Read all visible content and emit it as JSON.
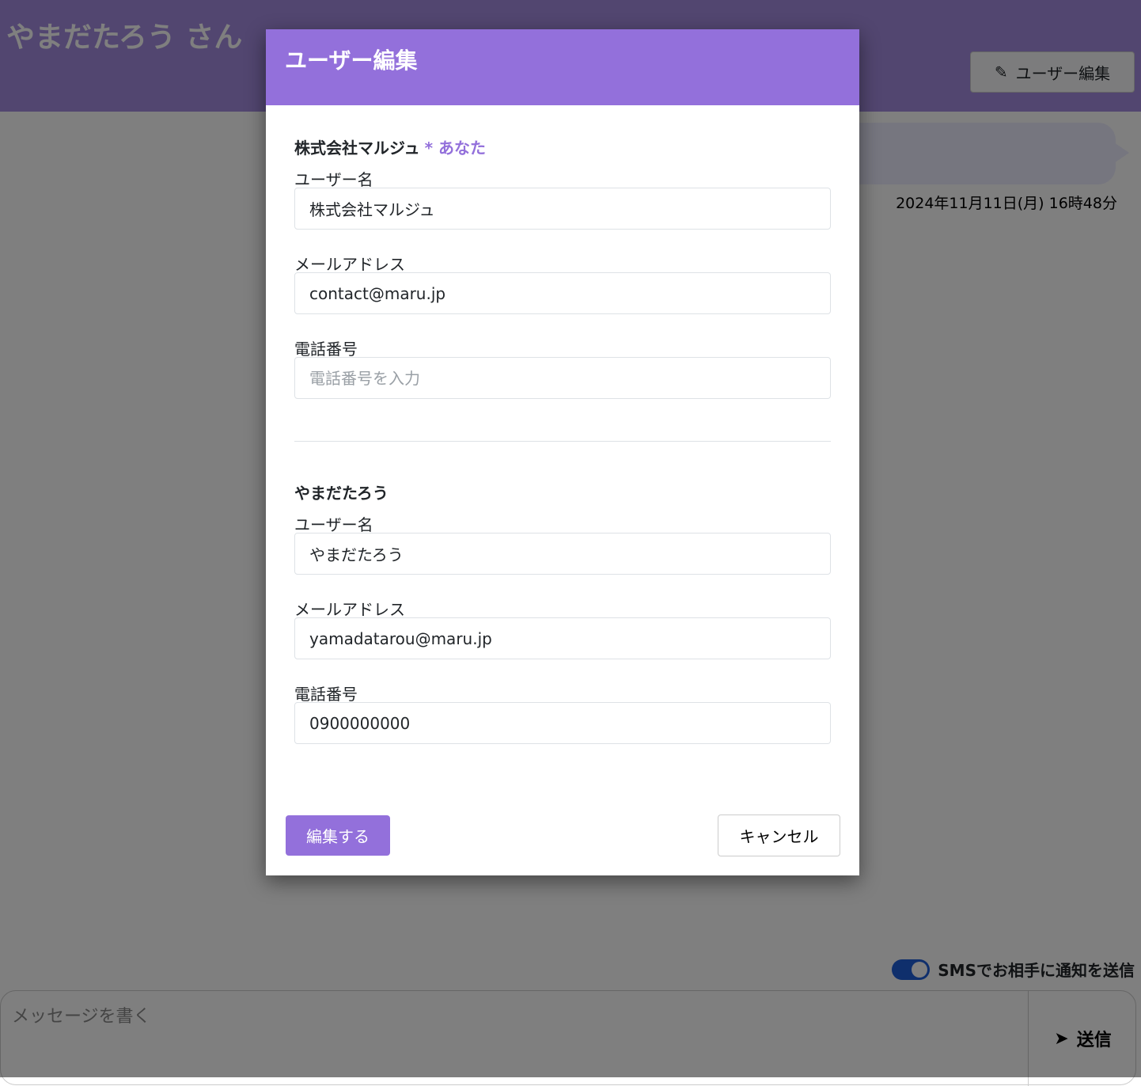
{
  "page": {
    "title": "やまだたろう さん",
    "edit_button": "ユーザー編集",
    "timestamp": "2024年11月11日(月) 16時48分",
    "sms_toggle_label": "SMSでお相手に通知を送信",
    "sms_toggle_on": true,
    "message_placeholder": "メッセージを書く",
    "send_label": "送信"
  },
  "modal": {
    "title": "ユーザー編集",
    "users": [
      {
        "name": "株式会社マルジュ",
        "you_marker": "* あなた",
        "username_label": "ユーザー名",
        "username": "株式会社マルジュ",
        "email_label": "メールアドレス",
        "email": "contact@maru.jp",
        "phone_label": "電話番号",
        "phone": "",
        "phone_placeholder": "電話番号を入力"
      },
      {
        "name": "やまだたろう",
        "username_label": "ユーザー名",
        "username": "やまだたろう",
        "email_label": "メールアドレス",
        "email": "yamadatarou@maru.jp",
        "phone_label": "電話番号",
        "phone": "0900000000"
      }
    ],
    "submit_label": "編集する",
    "cancel_label": "キャンセル"
  },
  "colors": {
    "accent": "#9370db",
    "toggle": "#1f5ed8"
  }
}
